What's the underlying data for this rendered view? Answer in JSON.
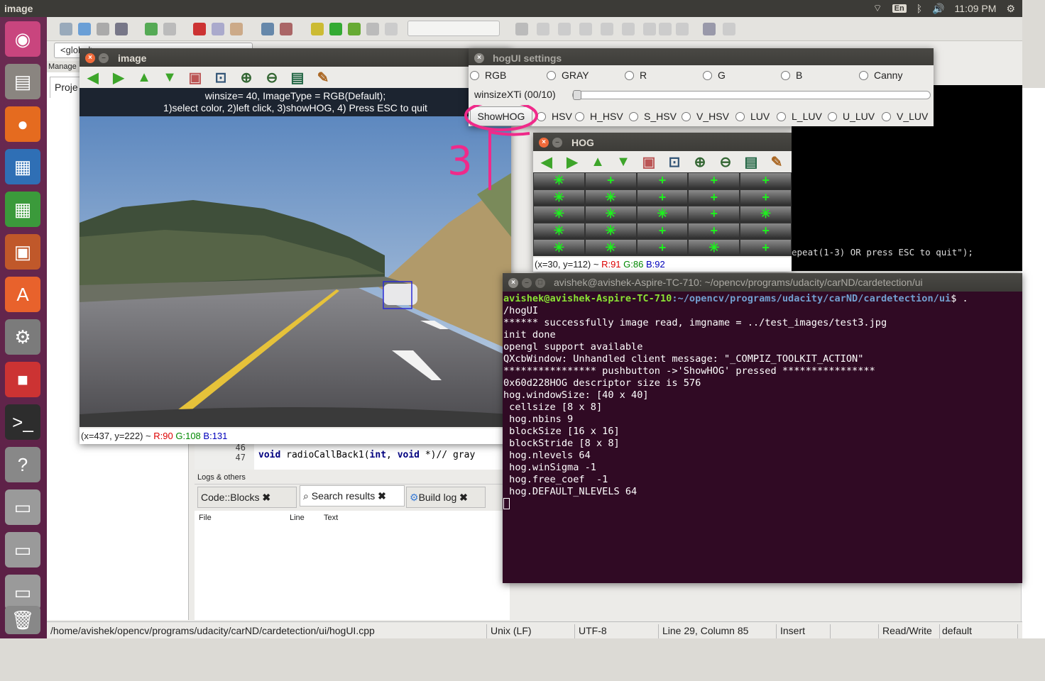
{
  "topbar": {
    "title": "image",
    "keyboard": "En",
    "time": "11:09 PM"
  },
  "ide": {
    "global_combo": "<global>",
    "left_header": "Manage",
    "left_tab": "Proje",
    "code_lines": [
      "46",
      "47"
    ],
    "code_text_kw1": "void",
    "code_text_fn": " radioCallBack1(",
    "code_text_kw2": "int",
    "code_text_mid": ", ",
    "code_text_kw3": "void",
    "code_text_end": " *)// gray",
    "logs_header": "Logs & others",
    "log_tabs": [
      "Code::Blocks",
      "Search results",
      "Build log"
    ],
    "log_cols": [
      "File",
      "Line",
      "Text"
    ],
    "status": {
      "path": "/home/avishek/opencv/programs/udacity/carND/cardetection/ui/hogUI.cpp",
      "eol": "Unix (LF)",
      "enc": "UTF-8",
      "pos": "Line 29, Column 85",
      "mode": "Insert",
      "rw": "Read/Write",
      "prof": "default"
    },
    "dark_code": "epeat(1-3) OR press ESC to quit\");"
  },
  "image_win": {
    "title": "image",
    "banner_line1": "winsize= 40,  ImageType = RGB(Default);",
    "banner_line2": "1)select color, 2)left click, 3)showHOG, 4) Press ESC to quit",
    "status_xy": "(x=437, y=222) ~ ",
    "status_r": "R:90",
    "status_g": "G:108",
    "status_b": "B:131"
  },
  "hog_settings": {
    "title": "hogUI settings",
    "row1": [
      "RGB",
      "GRAY",
      "R",
      "G",
      "B",
      "Canny"
    ],
    "slider_label": "winsizeXTi (00/10)",
    "slider_value": 0,
    "button": "ShowHOG",
    "row3": [
      "HSV",
      "H_HSV",
      "S_HSV",
      "V_HSV",
      "LUV",
      "L_LUV",
      "U_LUV",
      "V_LUV"
    ]
  },
  "hog_win": {
    "title": "HOG",
    "status_xy": "(x=30, y=112) ~ ",
    "status_r": "R:91",
    "status_g": "G:86",
    "status_b": "B:92"
  },
  "annotation": "3",
  "terminal": {
    "title": "avishek@avishek-Aspire-TC-710: ~/opencv/programs/udacity/carND/cardetection/ui",
    "prompt_user": "avishek@avishek-Aspire-TC-710",
    "prompt_path": ":~/opencv/programs/udacity/carND/cardetection/ui",
    "prompt_cmd": "$ .",
    "lines": [
      "/hogUI",
      "****** successfully image read, imgname = ../test_images/test3.jpg",
      "init done",
      "opengl support available",
      "QXcbWindow: Unhandled client message: \"_COMPIZ_TOOLKIT_ACTION\"",
      "**************** pushbutton ->'ShowHOG' pressed ****************",
      "0x60d228HOG descriptor size is 576",
      "hog.windowSize: [40 x 40]",
      " cellsize [8 x 8]",
      " hog.nbins 9",
      " blockSize [16 x 16]",
      " blockStride [8 x 8]",
      " hog.nlevels 64",
      " hog.winSigma -1",
      " hog.free_coef  -1",
      " hog.DEFAULT_NLEVELS 64"
    ]
  }
}
